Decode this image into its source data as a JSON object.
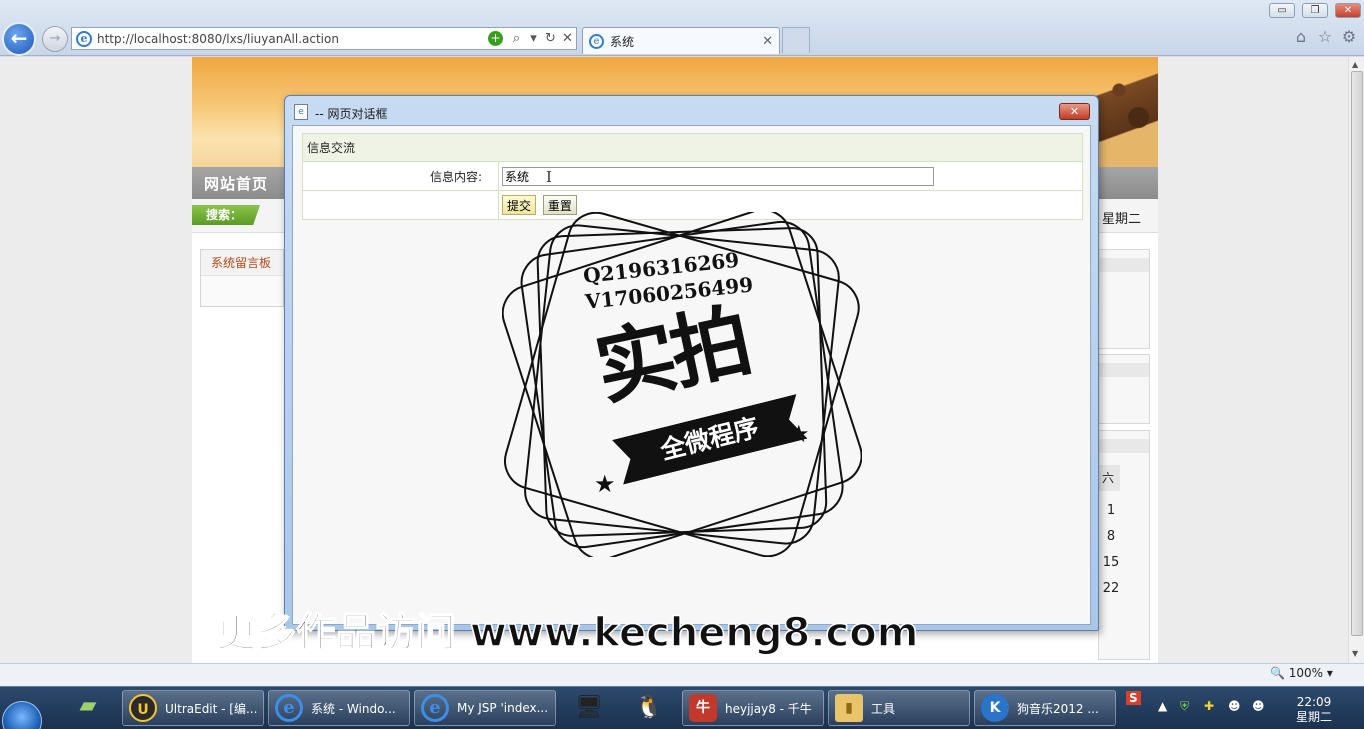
{
  "browser": {
    "url": "http://localhost:8080/lxs/liuyanAll.action",
    "tab_title": "系统",
    "window_buttons": {
      "minimize": "▭",
      "maximize": "❐",
      "close": "✕"
    }
  },
  "site": {
    "nav_home": "网站首页",
    "search_label": "搜索：",
    "weekday": "星期二",
    "message_board_title": "系统留言板",
    "calendar": {
      "saturday_header": "六",
      "saturday_dates": [
        "1",
        "8",
        "15",
        "22"
      ]
    }
  },
  "dialog": {
    "title": "-- 网页对话框",
    "form_header": "信息交流",
    "content_label": "信息内容:",
    "content_value": "系统",
    "submit_label": "提交",
    "reset_label": "重置"
  },
  "watermark": {
    "qq": "Q2196316269",
    "wechat": "V17060256499",
    "main": "实拍",
    "ribbon": "全微程序",
    "caption": "更多作品访问 www.kecheng8.com"
  },
  "statusbar": {
    "zoom": "100%"
  },
  "taskbar": {
    "items": [
      {
        "label": "UltraEdit - [编...",
        "icon": "ultraedit-icon"
      },
      {
        "label": "系统 - Windo...",
        "icon": "ie-icon"
      },
      {
        "label": "My JSP 'index...",
        "icon": "ie-icon"
      },
      {
        "label": "heyjjay8 - 千牛",
        "icon": "qianniu-icon"
      },
      {
        "label": "工具",
        "icon": "folder-icon"
      },
      {
        "label": "狗音乐2012 ...",
        "icon": "kugou-icon"
      }
    ],
    "clock_time": "22:09",
    "clock_day": "星期二"
  }
}
